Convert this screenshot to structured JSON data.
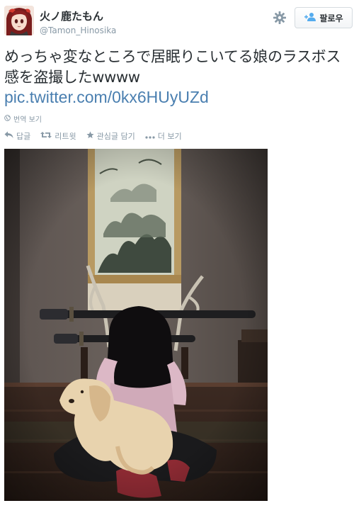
{
  "user": {
    "display_name": "火ノ鹿たもん",
    "screen_name": "@Tamon_Hinosika",
    "avatar_icon": "avatar-anime-girl"
  },
  "header": {
    "settings_icon": "gear-icon",
    "follow_icon": "add-user-icon",
    "follow_label": "팔로우"
  },
  "tweet": {
    "text": "めっちゃ変なところで居眠りこいてる娘のラスボス感を盗撮したwwww",
    "link": "pic.twitter.com/0kx6HUyUZd",
    "link_color": "#4a7fb0"
  },
  "translate": {
    "icon": "globe-icon",
    "label": "번역 보기"
  },
  "actions": {
    "reply_label": "답글",
    "retweet_label": "리트윗",
    "favorite_label": "관심글 담기",
    "more_label": "더 보기"
  },
  "photo": {
    "description_icon": "attached-photo"
  }
}
